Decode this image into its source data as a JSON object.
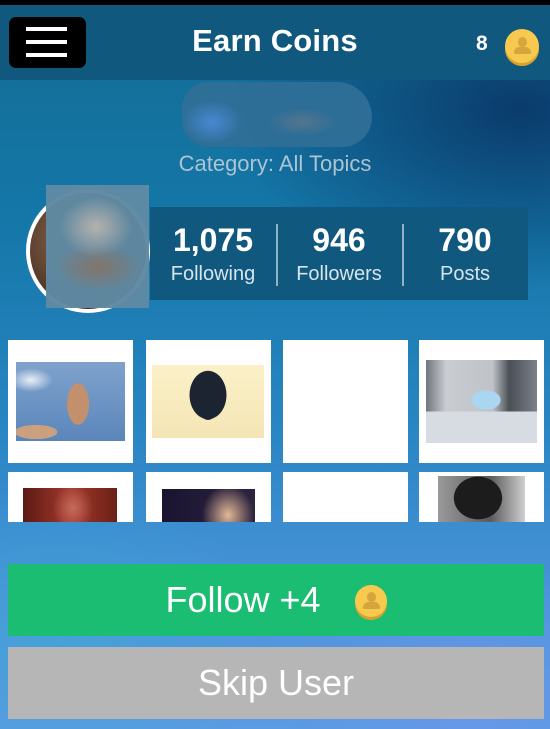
{
  "header": {
    "title": "Earn Coins",
    "menu_icon": "hamburger-menu-icon",
    "coin_balance": "8",
    "coin_icon": "coin-icon"
  },
  "profile": {
    "category": "Category: All Topics",
    "stats": [
      {
        "value": "1,075",
        "label": "Following"
      },
      {
        "value": "946",
        "label": "Followers"
      },
      {
        "value": "790",
        "label": "Posts"
      }
    ]
  },
  "posts": [
    {
      "subject": "hand-against-sky-photo"
    },
    {
      "subject": "person-with-camera-photo"
    },
    {
      "subject": "blank-photo"
    },
    {
      "subject": "piano-outdoors-photo"
    },
    {
      "subject": "red-selfie-photo"
    },
    {
      "subject": "face-closeup-photo"
    },
    {
      "subject": "blank-photo"
    },
    {
      "subject": "curly-hair-photo"
    }
  ],
  "actions": {
    "follow_label": "Follow +4",
    "skip_label": "Skip User"
  },
  "colors": {
    "appbar": "#11587e",
    "follow": "#1bbd72",
    "skip": "#b6b6b6",
    "coin": "#f7c94f"
  }
}
